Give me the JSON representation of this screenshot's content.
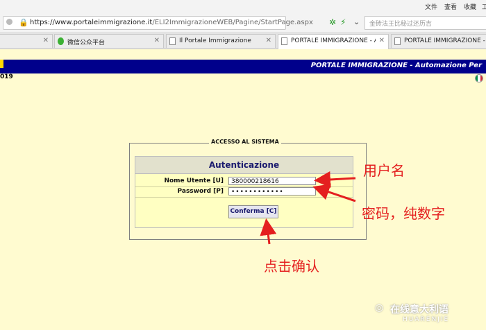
{
  "browser": {
    "menu": [
      "文件",
      "查看",
      "收藏",
      "工"
    ],
    "url_host": "https://www.portaleimmigrazione.it",
    "url_path": "/ELI2ImmigrazioneWEB/Pagine/StartPage.aspx",
    "search_placeholder": "金砖法王比秘过还历吉",
    "tabs": [
      {
        "label": "微信公众平台"
      },
      {
        "label": "Il Portale Immigrazione"
      },
      {
        "label": "PORTALE IMMIGRAZIONE - Autom"
      },
      {
        "label": "PORTALE IMMIGRAZIONE - Autom"
      }
    ]
  },
  "page": {
    "header_title": "PORTALE IMMIGRAZIONE - Automazione Per",
    "year_fragment": "019",
    "flag_colors": [
      "#009246",
      "#ffffff",
      "#ce2b37"
    ]
  },
  "login": {
    "legend": "ACCESSO AL SISTEMA",
    "heading": "Autenticazione",
    "username_label": "Nome Utente [U]",
    "username_value": "380000218616",
    "password_label": "Password [P]",
    "password_value": "••••••••••••",
    "confirm_label": "Conferma [C]"
  },
  "annotations": {
    "username_note": "用户名",
    "password_note": "密码，纯数字",
    "confirm_note": "点击确认",
    "color": "#e41f1f"
  },
  "watermark": {
    "text": "在线意大利语",
    "sub": "HUARENJIE"
  }
}
